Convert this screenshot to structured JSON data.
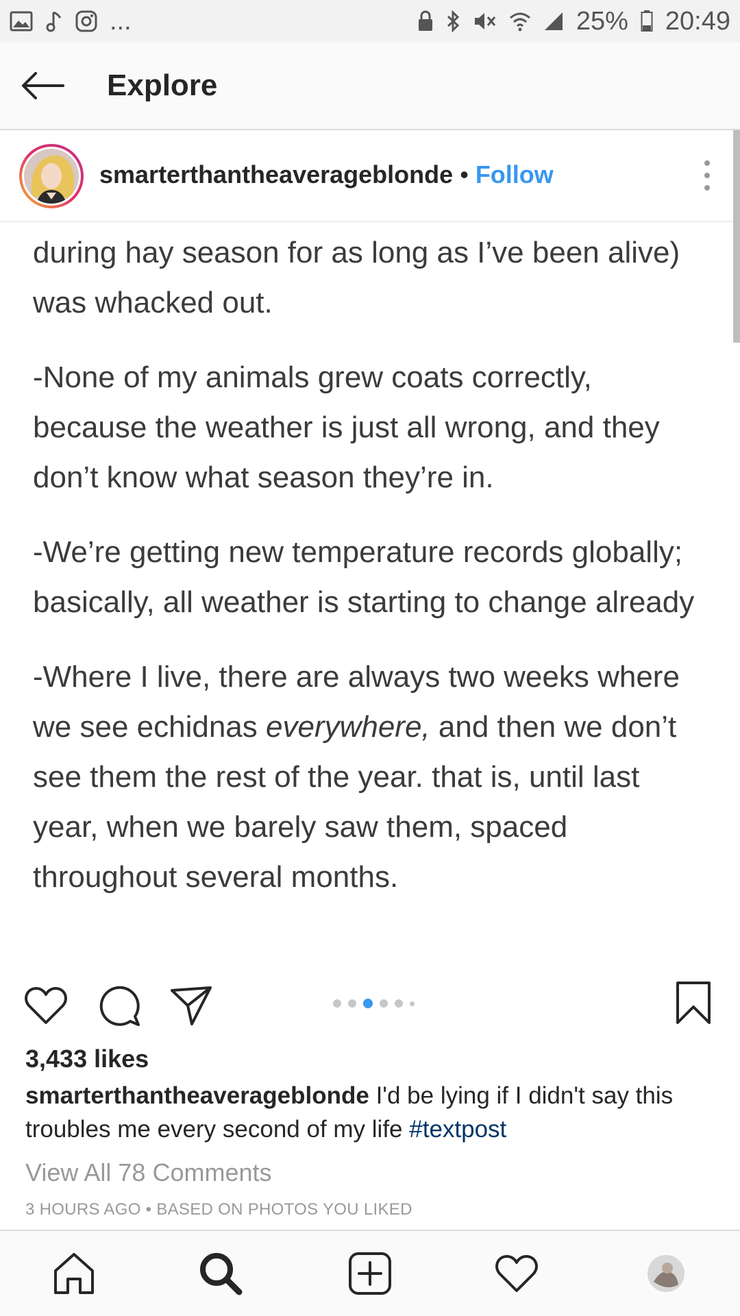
{
  "status_bar": {
    "left_icons": [
      "image-icon",
      "music-note-icon",
      "instagram-icon"
    ],
    "overflow": "...",
    "battery": "25%",
    "time": "20:49"
  },
  "topbar": {
    "title": "Explore"
  },
  "post": {
    "username": "smarterthantheaverageblonde",
    "separator": "•",
    "follow_label": "Follow",
    "paragraphs": [
      {
        "text": "during hay season for as long as I’ve been alive) was whacked out."
      },
      {
        "text": "-None of my animals grew coats correctly, because the weather is just all wrong, and they don’t know what season they’re in."
      },
      {
        "text": "-We’re getting new temperature records globally; basically, all weather is starting to change already"
      },
      {
        "before": "-Where I live, there are always two weeks where we see echidnas ",
        "emphasis": "everywhere,",
        "after": " and then we don’t see them the rest of the year. that is, until last year, when we barely saw them, spaced throughout several months."
      }
    ],
    "carousel": {
      "count": 6,
      "active_index": 2
    },
    "likes": "3,433 likes",
    "caption_user": "smarterthantheaverageblonde",
    "caption_text": "I'd be lying if I didn't say this troubles me every second of my life",
    "caption_hashtag": "#textpost",
    "view_comments": "View All 78 Comments",
    "timestamp": "3 HOURS AGO • BASED ON PHOTOS YOU LIKED"
  },
  "bottom_nav": [
    "home-icon",
    "search-icon",
    "add-post-icon",
    "activity-heart-icon",
    "profile-avatar"
  ],
  "colors": {
    "link_blue": "#3897f0",
    "hashtag": "#003569",
    "muted": "#999999",
    "text": "#262626"
  }
}
